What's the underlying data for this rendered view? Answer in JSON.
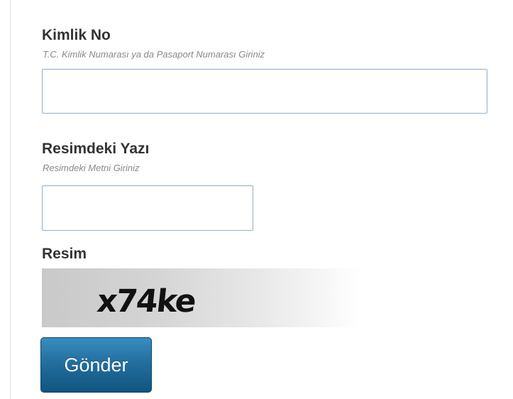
{
  "kimlik": {
    "title": "Kimlik No",
    "hint": "T.C. Kimlik Numarası ya da Pasaport Numarası Giriniz",
    "value": ""
  },
  "resim_yazi": {
    "title": "Resimdeki Yazı",
    "hint": "Resimdeki Metni Giriniz",
    "value": ""
  },
  "resim": {
    "title": "Resim",
    "captcha_text": "x74ke"
  },
  "submit": {
    "label": "Gönder"
  },
  "colors": {
    "input_border": "#8fb3cf",
    "button_top": "#3a8cbf",
    "button_bottom": "#11557f",
    "title_text": "#333333",
    "hint_text": "#888888"
  }
}
